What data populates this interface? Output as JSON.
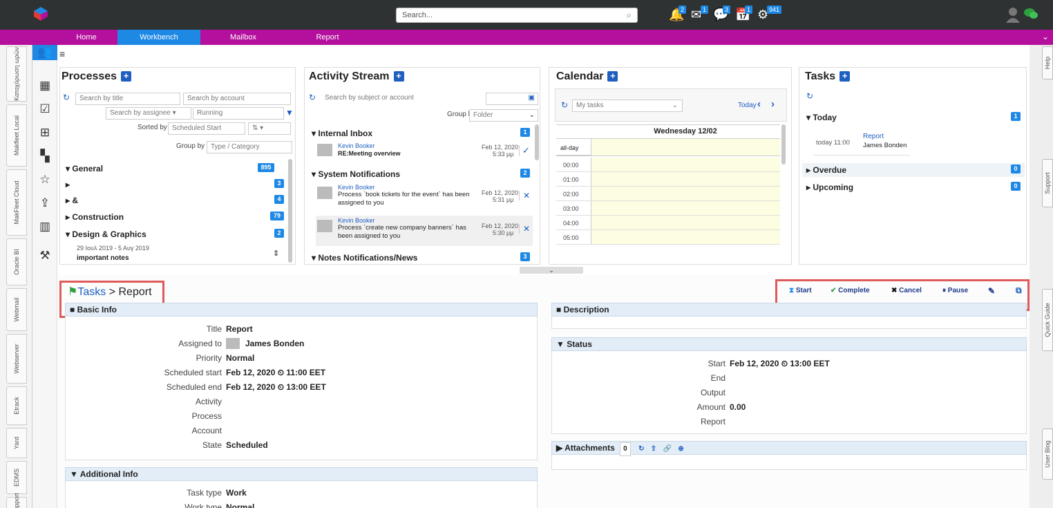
{
  "topbar": {
    "search_placeholder": "Search...",
    "icons": [
      {
        "name": "bell-icon",
        "glyph": "🔔",
        "badge": "2"
      },
      {
        "name": "mail-icon",
        "glyph": "✉",
        "badge": "1"
      },
      {
        "name": "chat-icon",
        "glyph": "💬",
        "badge": "3"
      },
      {
        "name": "calendar-icon",
        "glyph": "📅",
        "badge": "1"
      },
      {
        "name": "gears-icon",
        "glyph": "⚙",
        "badge": "941"
      }
    ]
  },
  "nav": {
    "tabs": [
      "Home",
      "Workbench",
      "Mailbox",
      "Report"
    ],
    "active": "Workbench"
  },
  "left_vertical_tabs": [
    "Κατοχύρωση ωρών",
    "Makfleet Local",
    "MakFleet Cloud",
    "Oracle BI",
    "Webmail",
    "Webserver",
    "Etrack",
    "Yard",
    "EDMS",
    "Support"
  ],
  "right_vertical_tabs": [
    "Help",
    "Support",
    "Quick Guide",
    "User Blog"
  ],
  "processes": {
    "title": "Processes",
    "search_title": "Search by title",
    "search_account": "Search by account",
    "search_assignee": "Search by assignee",
    "status": "Running",
    "sorted_by_label": "Sorted by",
    "sorted_by_value": "Scheduled Start",
    "group_by_label": "Group by",
    "group_by_value": "Type / Category",
    "groups": [
      {
        "label": "General",
        "count": "895",
        "arrow": "▾"
      },
      {
        "label": "",
        "count": "3",
        "arrow": "▸"
      },
      {
        "label": "&",
        "count": "4",
        "arrow": "▸"
      },
      {
        "label": "Construction",
        "count": "79",
        "arrow": "▸"
      },
      {
        "label": "Design & Graphics",
        "count": "2",
        "arrow": "▾"
      }
    ],
    "item_date": "29 Ιουλ 2019 - 5 Αυγ 2019",
    "item_title": "important notes"
  },
  "activity": {
    "title": "Activity Stream",
    "search_placeholder": "Search by subject or account",
    "group_by_label": "Group by",
    "group_by_value": "Folder",
    "sections": [
      {
        "label": "Internal Inbox",
        "count": "1"
      },
      {
        "label": "System Notifications",
        "count": "2"
      },
      {
        "label": "Notes Notifications/News",
        "count": "3"
      }
    ],
    "items": [
      {
        "author": "Kevin Booker",
        "text": "RE:Meeting overview",
        "date": "Feb 12, 2020",
        "time": "5:33 μμ",
        "mark": "✓"
      },
      {
        "author": "Kevin Booker",
        "text": "Process `book tickets for the event` has been assigned to you",
        "date": "Feb 12, 2020",
        "time": "5:31 μμ",
        "mark": "✕"
      },
      {
        "author": "Kevin Booker",
        "text": "Process `create new company banners` has been assigned to you",
        "date": "Feb 12, 2020",
        "time": "5:30 μμ",
        "mark": "✕"
      }
    ]
  },
  "calendar": {
    "title": "Calendar",
    "filter": "My tasks",
    "today_label": "Today",
    "day_header": "Wednesday 12/02",
    "allday": "all-day",
    "hours": [
      "00:00",
      "01:00",
      "02:00",
      "03:00",
      "04:00",
      "05:00"
    ]
  },
  "tasks_panel": {
    "title": "Tasks",
    "today_label": "Today",
    "today_count": "1",
    "item_time": "today 11:00",
    "item_title": "Report",
    "item_person": "James Bonden",
    "overdue_label": "Overdue",
    "overdue_count": "0",
    "upcoming_label": "Upcoming",
    "upcoming_count": "0"
  },
  "detail": {
    "breadcrumb_root": "Tasks",
    "breadcrumb_sep": ">",
    "breadcrumb_current": "Report",
    "actions": {
      "start": "Start",
      "complete": "Complete",
      "cancel": "Cancel",
      "pause": "Pause"
    },
    "basic_info_title": "Basic Info",
    "basic_info": [
      {
        "label": "Title",
        "value": "Report"
      },
      {
        "label": "Assigned to",
        "value": "James Bonden"
      },
      {
        "label": "Priority",
        "value": "Normal"
      },
      {
        "label": "Scheduled start",
        "value": "Feb 12, 2020 ⏲ 11:00 EET"
      },
      {
        "label": "Scheduled end",
        "value": "Feb 12, 2020 ⏲ 13:00 EET"
      },
      {
        "label": "Activity",
        "value": ""
      },
      {
        "label": "Process",
        "value": ""
      },
      {
        "label": "Account",
        "value": ""
      },
      {
        "label": "State",
        "value": "Scheduled"
      }
    ],
    "additional_info_title": "Additional Info",
    "additional_info": [
      {
        "label": "Task type",
        "value": "Work"
      },
      {
        "label": "Work type",
        "value": "Normal"
      }
    ],
    "description_title": "Description",
    "status_title": "Status",
    "status": [
      {
        "label": "Start",
        "value": "Feb 12, 2020 ⏲ 13:00 EET"
      },
      {
        "label": "End",
        "value": ""
      },
      {
        "label": "Output",
        "value": ""
      },
      {
        "label": "Amount",
        "value": "0.00"
      },
      {
        "label": "Report",
        "value": ""
      }
    ],
    "attachments_title": "Attachments",
    "attachments_count": "0"
  }
}
